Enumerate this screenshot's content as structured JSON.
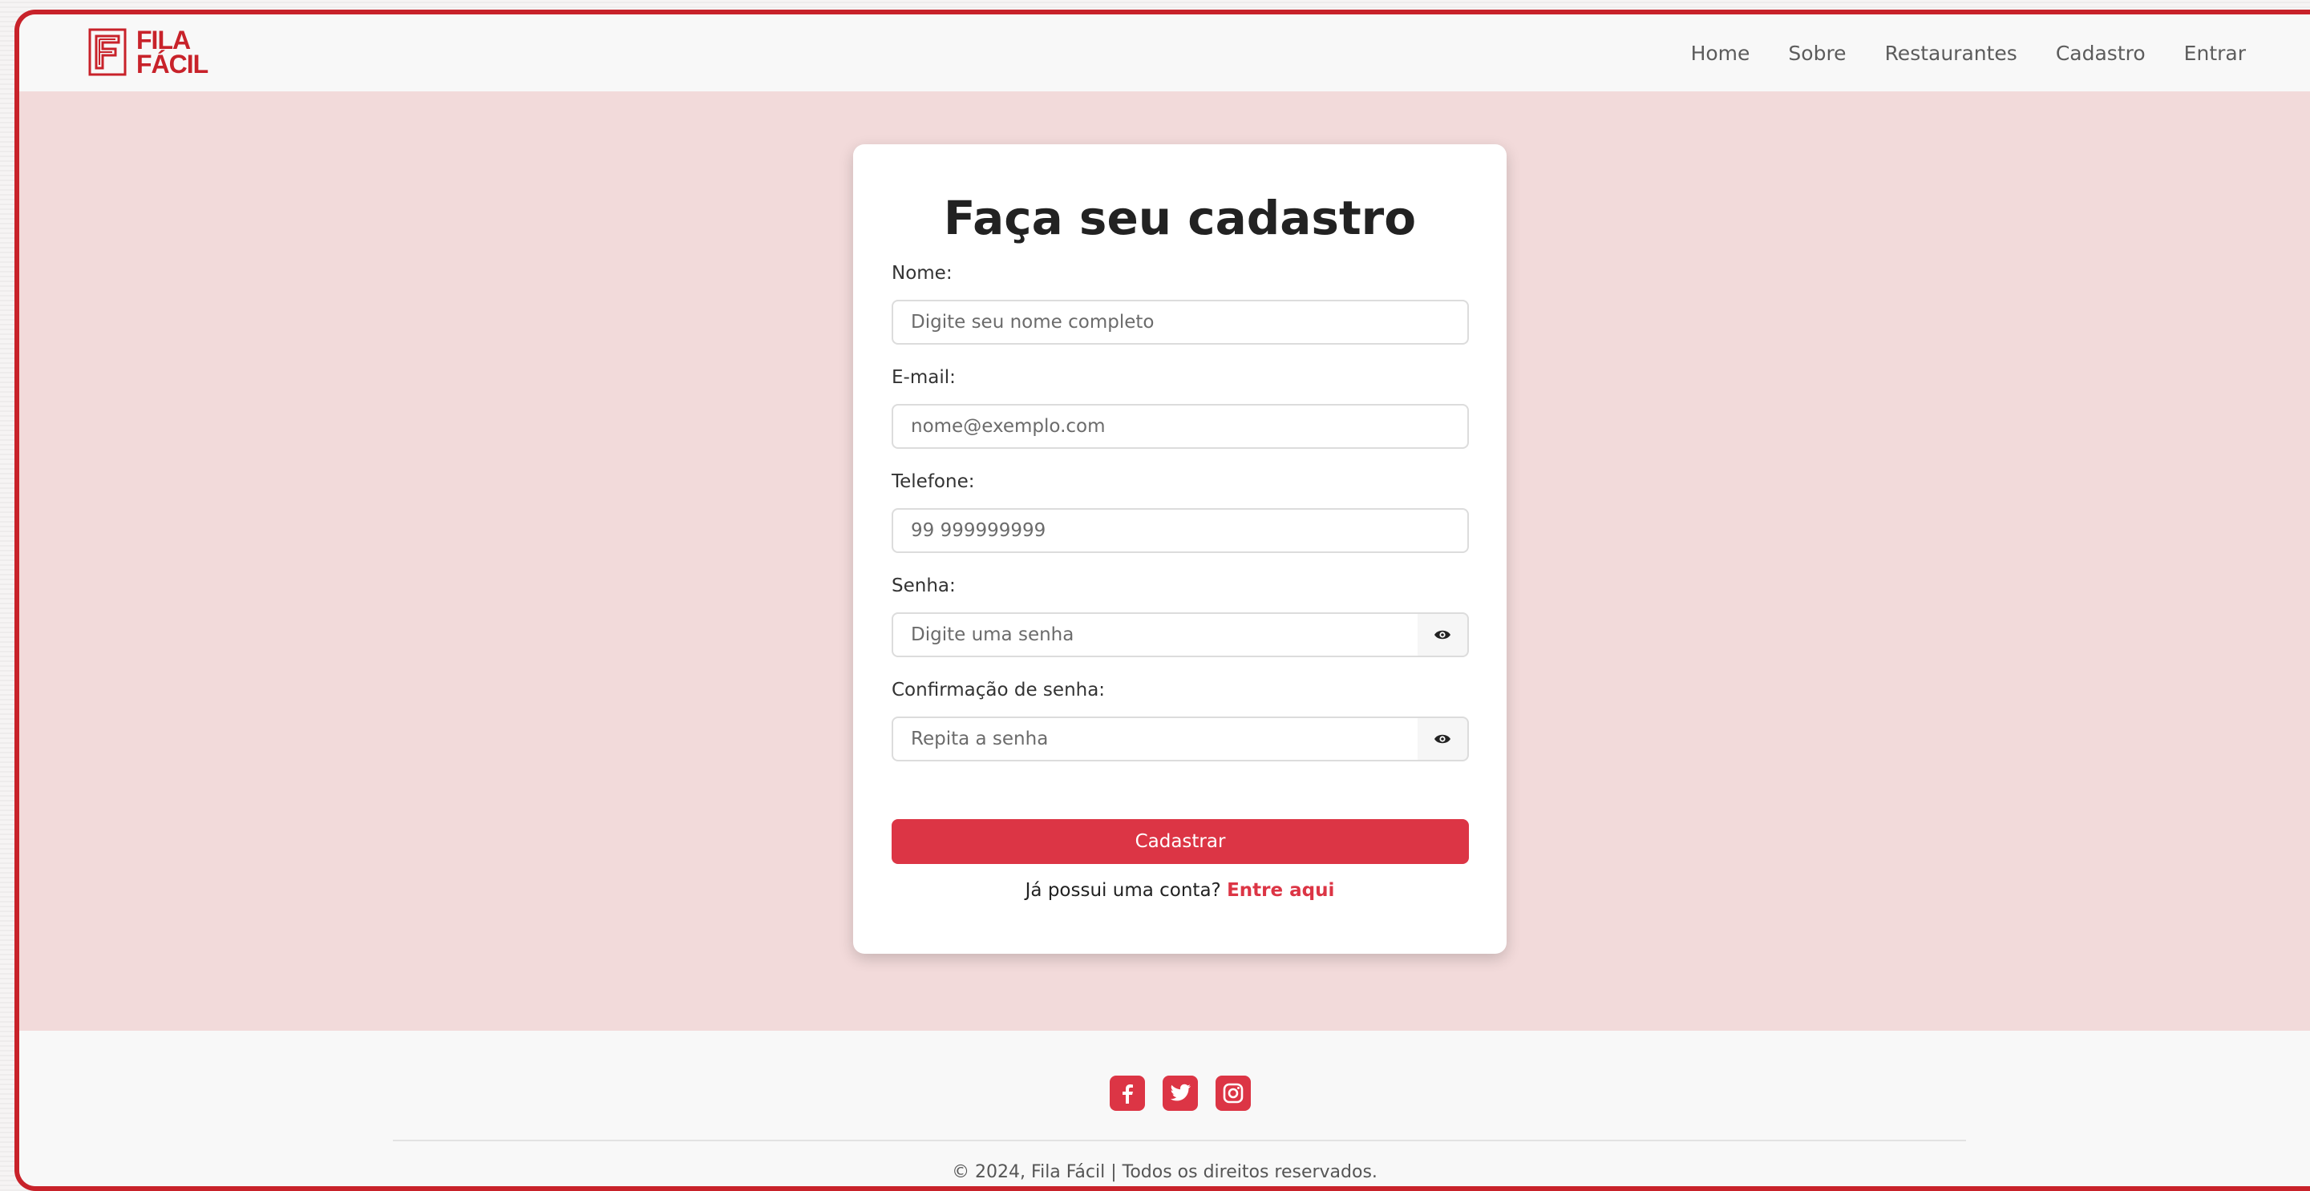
{
  "brand": {
    "line1": "FILA",
    "line2": "FÁCIL",
    "color": "#c8222a"
  },
  "nav": {
    "items": [
      {
        "label": "Home"
      },
      {
        "label": "Sobre"
      },
      {
        "label": "Restaurantes"
      },
      {
        "label": "Cadastro"
      },
      {
        "label": "Entrar"
      }
    ]
  },
  "form": {
    "title": "Faça seu cadastro",
    "fields": {
      "name": {
        "label": "Nome:",
        "placeholder": "Digite seu nome completo"
      },
      "email": {
        "label": "E-mail:",
        "placeholder": "nome@exemplo.com"
      },
      "phone": {
        "label": "Telefone:",
        "placeholder": "99 999999999"
      },
      "password": {
        "label": "Senha:",
        "placeholder": "Digite uma senha"
      },
      "confirm": {
        "label": "Confirmação de senha:",
        "placeholder": "Repita a senha"
      }
    },
    "submit_label": "Cadastrar",
    "login_prompt": "Já possui uma conta?",
    "login_link": "Entre aqui",
    "accent_color": "#dc3545"
  },
  "footer": {
    "social_icons": [
      "facebook-icon",
      "twitter-icon",
      "instagram-icon"
    ],
    "copyright": "© 2024, Fila Fácil | Todos os direitos reservados."
  }
}
